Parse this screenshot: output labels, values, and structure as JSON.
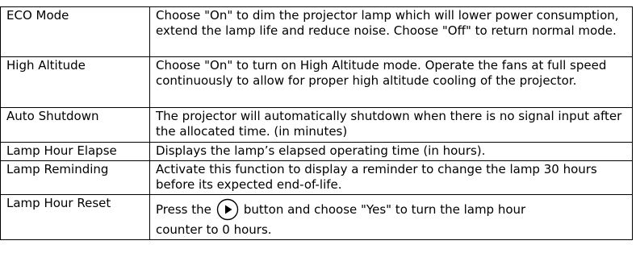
{
  "rows": [
    {
      "name": "ECO Mode",
      "description": "Choose \"On\" to dim the projector lamp which will lower power consumption, extend the lamp life and reduce noise. Choose \"Off\" to return normal mode."
    },
    {
      "name": "High Altitude",
      "description": "Choose \"On\" to turn on High Altitude mode. Operate the fans at full speed continuously to allow for proper high altitude cooling of the projector."
    },
    {
      "name": "Auto Shutdown",
      "description": "The projector will automatically shutdown when there is no signal input after the allocated time. (in minutes)"
    },
    {
      "name": "Lamp Hour Elapse",
      "description": "Displays the lamp’s elapsed operating time (in hours)."
    },
    {
      "name": "Lamp Reminding",
      "description": "Activate this function to display a reminder to change the lamp 30 hours before its expected end-of-life."
    },
    {
      "name": "Lamp Hour Reset",
      "description_before_icon": "Press the",
      "icon": "play-right-circle-icon",
      "description_after_icon": "button and choose \"Yes\" to turn the lamp hour",
      "description_line2": "counter to 0 hours."
    }
  ]
}
